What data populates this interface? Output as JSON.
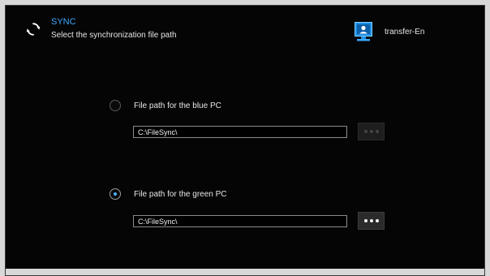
{
  "header": {
    "title": "SYNC",
    "subtitle": "Select the synchronization file path",
    "device_name": "transfer-En",
    "title_color": "#3fa8ff"
  },
  "options": [
    {
      "label": "File path for the blue PC",
      "path": "C:\\FileSync\\",
      "selected": false,
      "browse_enabled": false
    },
    {
      "label": "File path for the green PC",
      "path": "C:\\FileSync\\",
      "selected": true,
      "browse_enabled": true
    }
  ],
  "icons": {
    "sync": "sync-icon",
    "device": "monitor-user-icon",
    "browse": "ellipsis-icon"
  }
}
